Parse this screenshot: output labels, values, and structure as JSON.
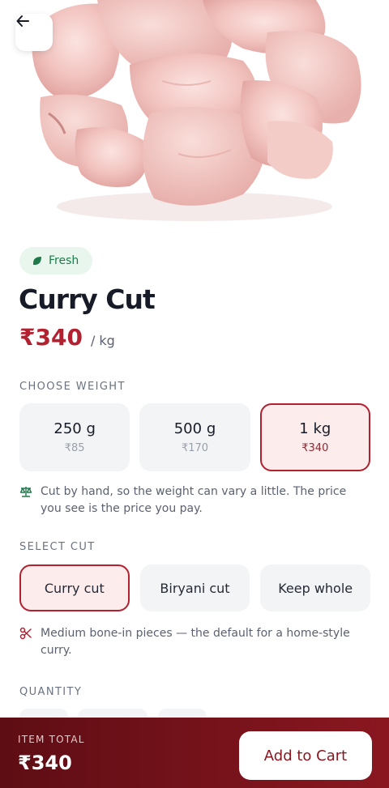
{
  "header": {
    "back_icon": "arrow-left-icon"
  },
  "product": {
    "image_alt": "chicken-curry-cut-pieces",
    "badge": {
      "icon": "leaf-icon",
      "label": "Fresh",
      "color": "#1e7a4a"
    },
    "title": "Curry Cut",
    "price": "₹340",
    "unit": "/ kg"
  },
  "weight": {
    "label": "CHOOSE WEIGHT",
    "options": [
      {
        "weight": "250 g",
        "price": "₹85",
        "selected": false
      },
      {
        "weight": "500 g",
        "price": "₹170",
        "selected": false
      },
      {
        "weight": "1 kg",
        "price": "₹340",
        "selected": true
      }
    ],
    "note": {
      "icon": "scale-icon",
      "text": "Cut by hand, so the weight can vary a little. The price you see is the price you pay."
    }
  },
  "cut": {
    "label": "SELECT CUT",
    "options": [
      {
        "label": "Curry cut",
        "selected": true
      },
      {
        "label": "Biryani cut",
        "selected": false
      },
      {
        "label": "Keep whole",
        "selected": false
      }
    ],
    "note": {
      "icon": "scissors-icon",
      "text": "Medium bone-in pieces — the default for a home-style curry."
    }
  },
  "quantity": {
    "label": "QUANTITY"
  },
  "footer": {
    "total_label": "ITEM TOTAL",
    "total_value": "₹340",
    "add_to_cart": "Add to Cart"
  },
  "colors": {
    "accent": "#b3202f",
    "footer_start": "#5e0d14",
    "footer_end": "#8a1720",
    "fresh_bg": "#e8f6ee"
  }
}
